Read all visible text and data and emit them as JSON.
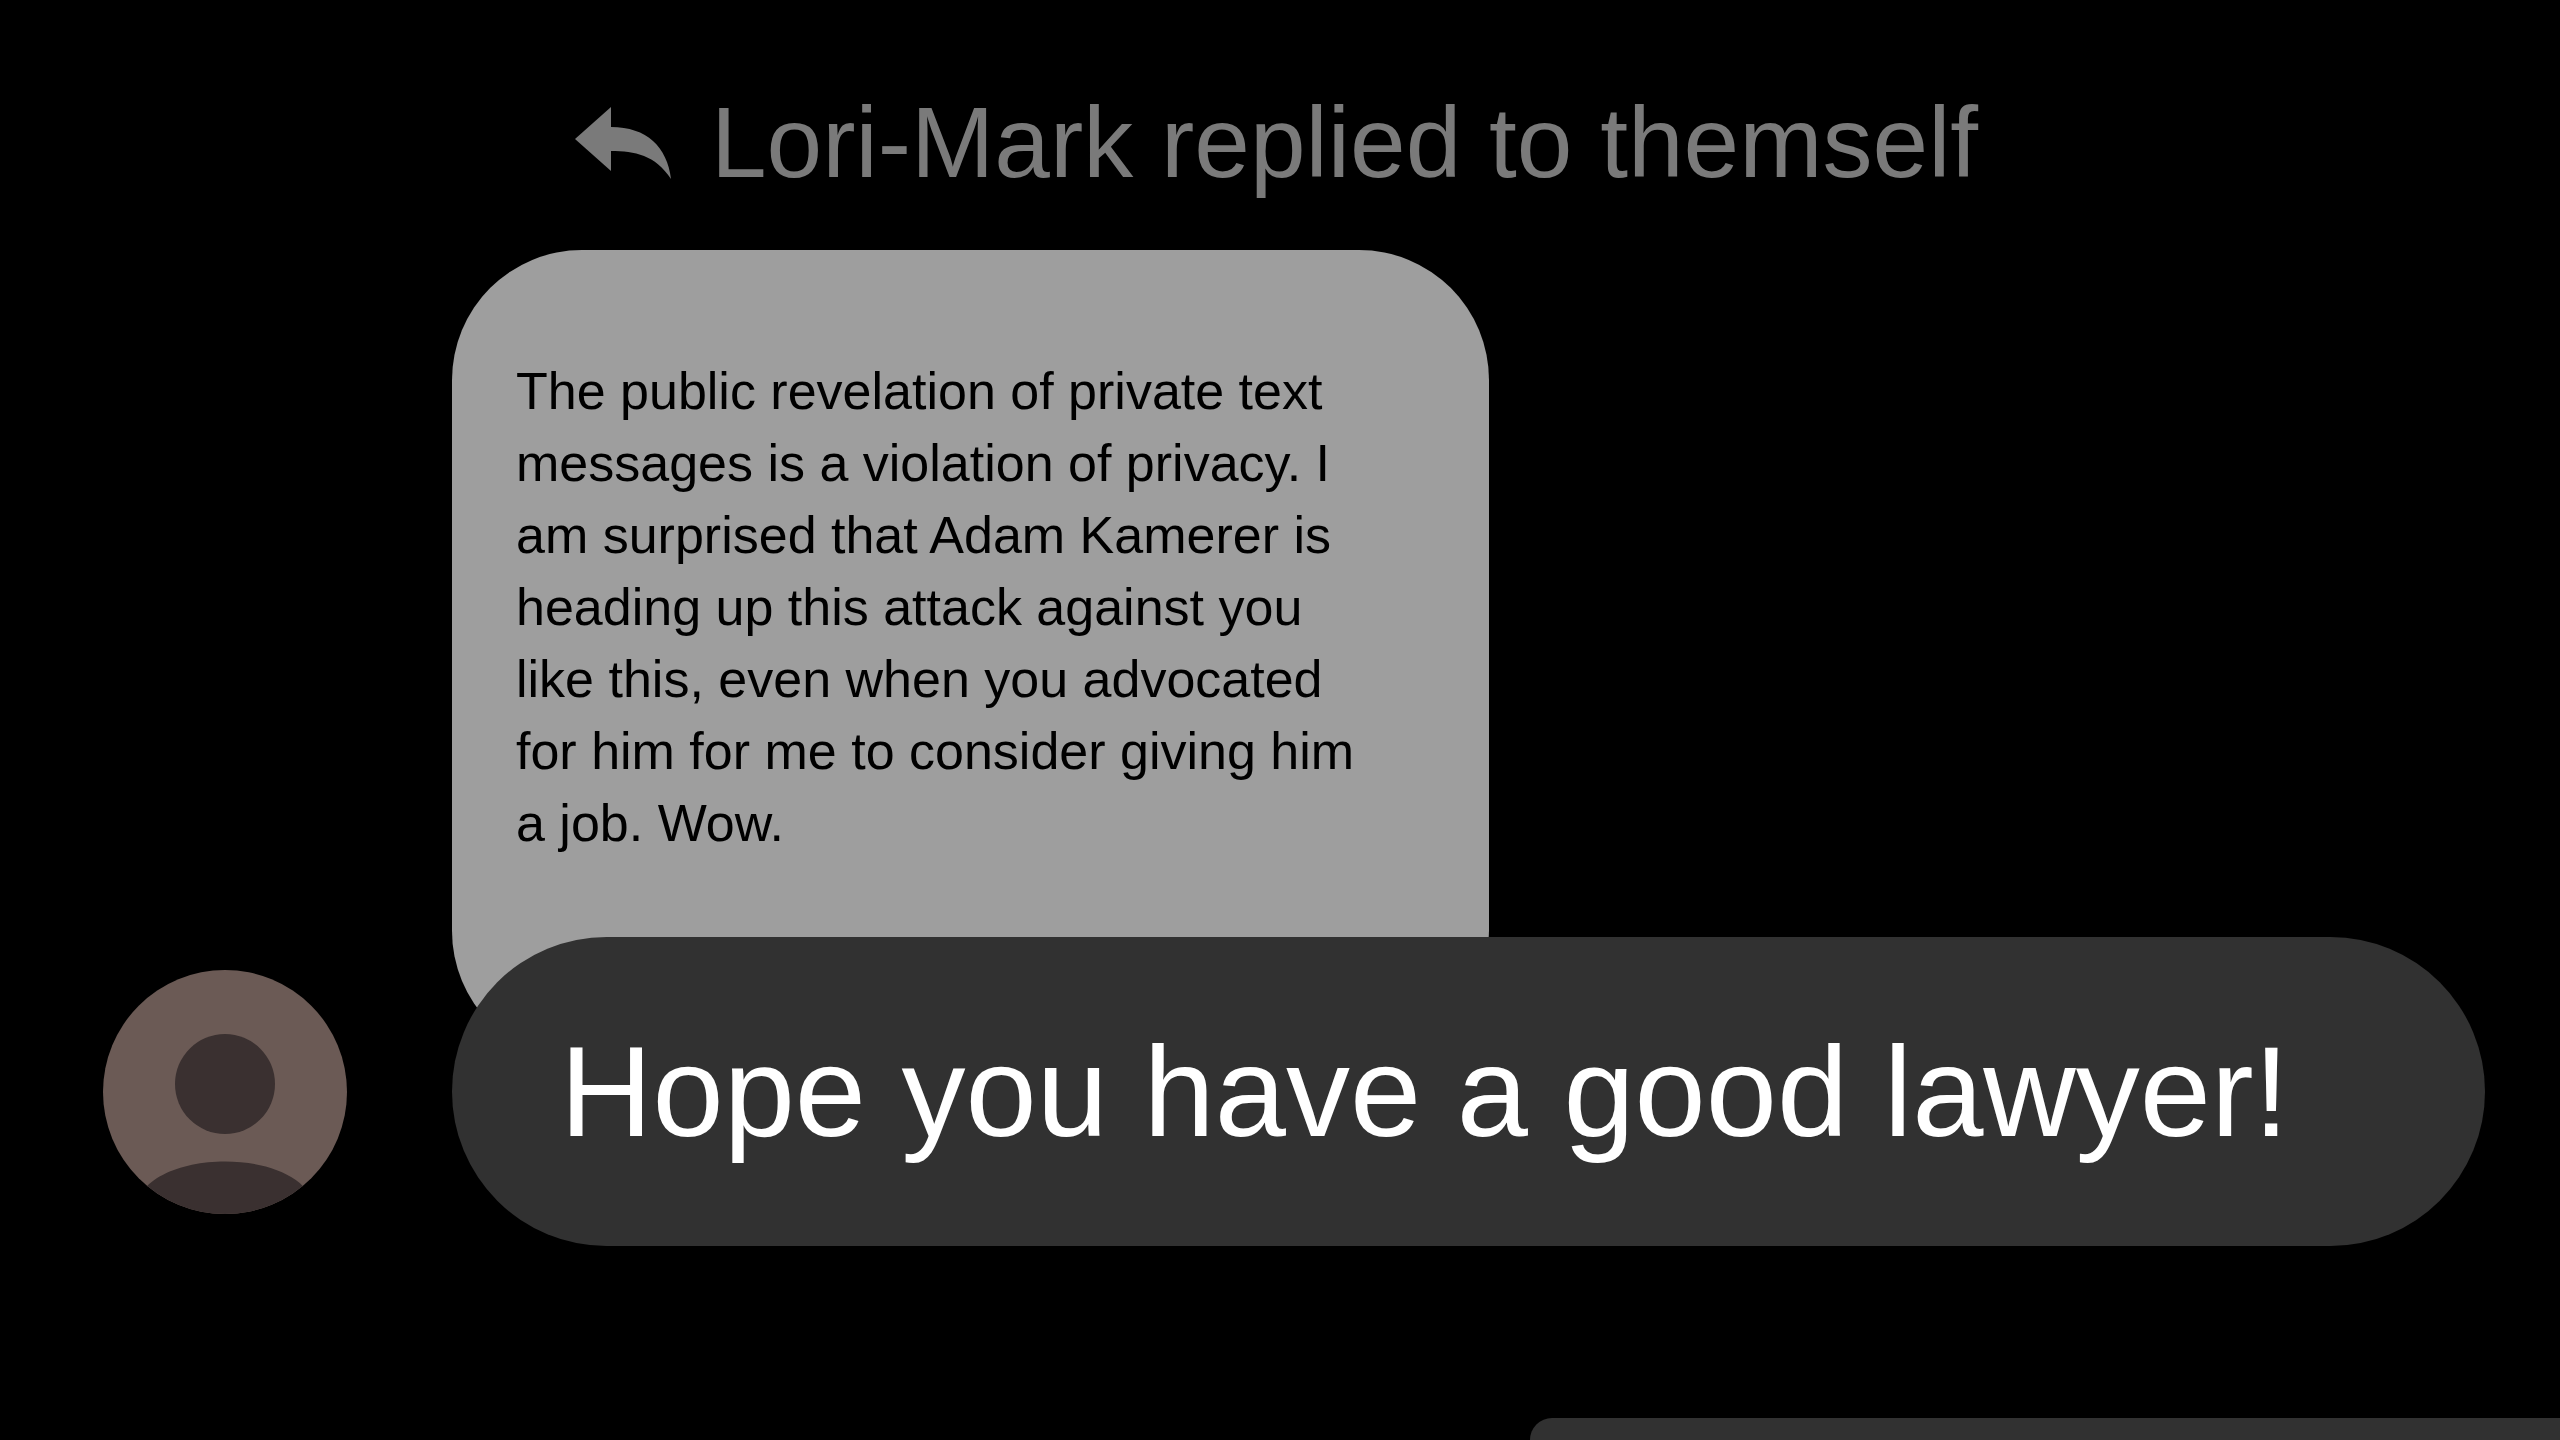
{
  "reply_header": {
    "text": "Lori-Mark replied to themself"
  },
  "quoted_message": {
    "text": "The public revelation of private text\nmessages is a violation of privacy. I\nam surprised that Adam Kamerer is\nheading up this attack against you\nlike this, even when you advocated\nfor him for me to consider giving him\na job. Wow."
  },
  "message": {
    "text": "Hope you have a good lawyer!"
  }
}
